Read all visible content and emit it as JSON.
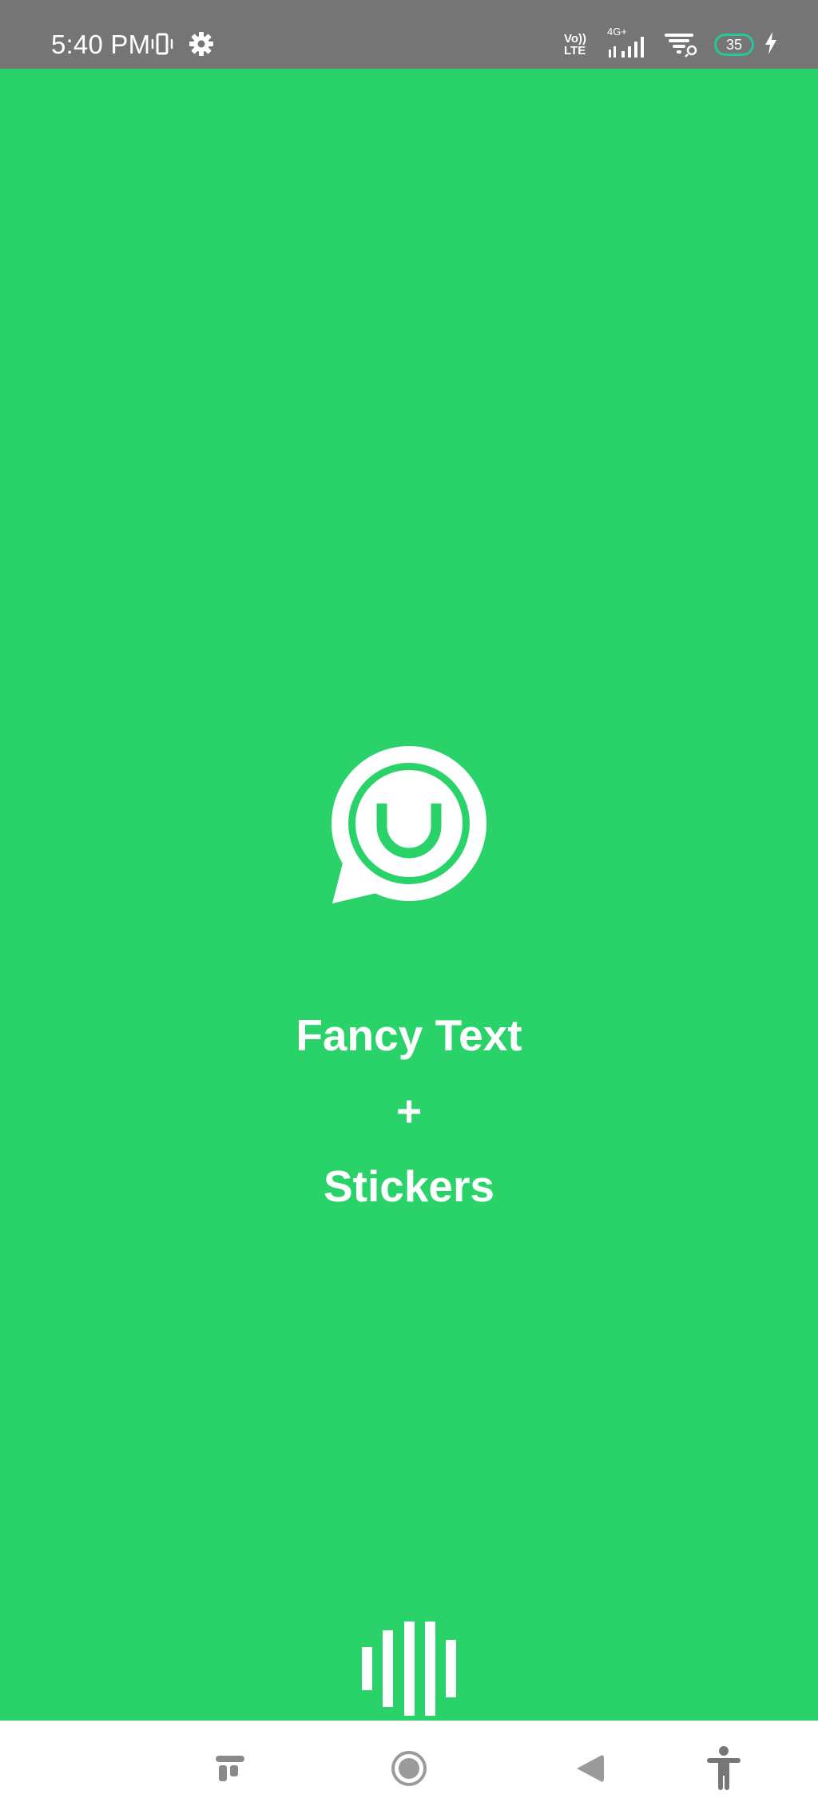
{
  "status_bar": {
    "time": "5:40 PM",
    "left_icons": [
      "vibrate-icon",
      "settings-gear-icon"
    ],
    "right_icons": [
      "volte-icon",
      "signal-icon",
      "wifi-icon",
      "battery-icon",
      "charging-icon"
    ],
    "volte_line1": "Vo))",
    "volte_line2": "LTE",
    "network_type": "4G+",
    "battery_level": "35"
  },
  "splash": {
    "background_color": "#2ad36a",
    "logo_icon": "smiley-chat-bubble-icon",
    "title_line_1": "Fancy Text",
    "title_line_2": "+",
    "title_line_3": "Stickers",
    "loader_icon": "loading-bars-icon"
  },
  "nav_bar": {
    "buttons": [
      "recents-icon",
      "home-icon",
      "back-icon",
      "accessibility-icon"
    ]
  }
}
